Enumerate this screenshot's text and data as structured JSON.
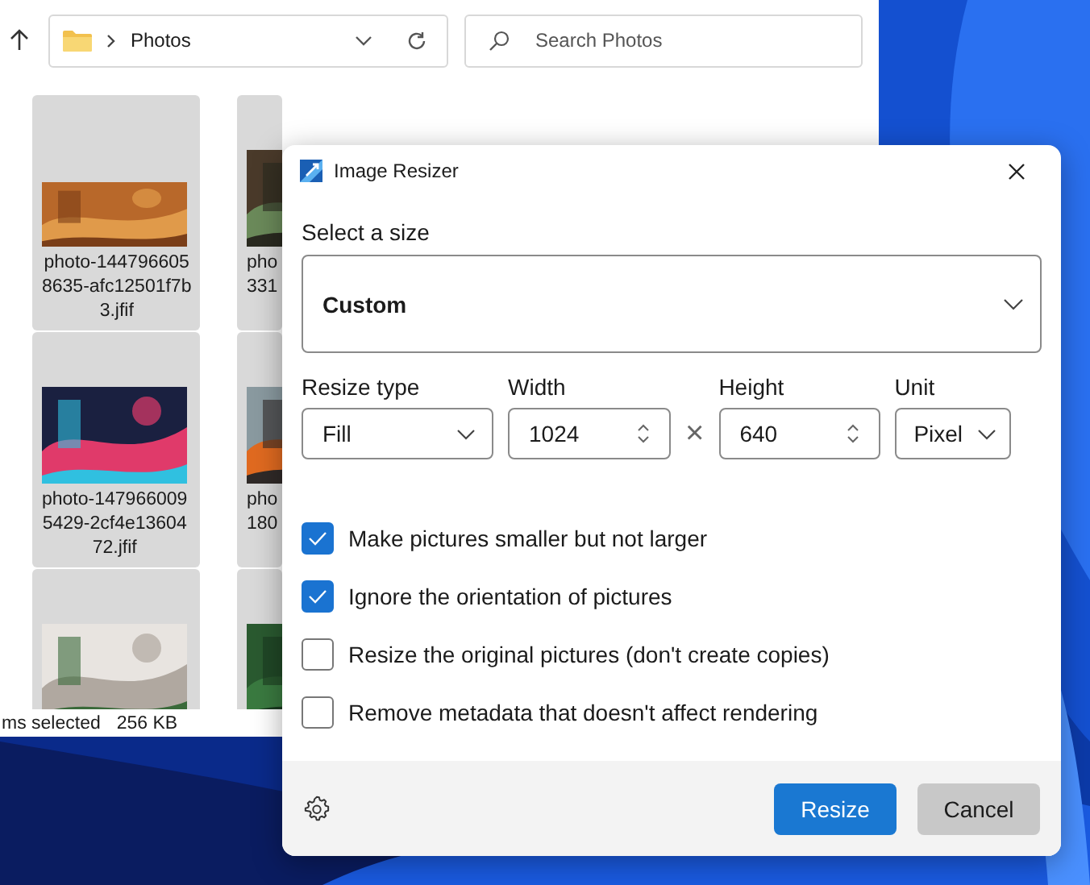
{
  "explorer": {
    "address": {
      "location": "Photos"
    },
    "search": {
      "placeholder": "Search Photos"
    },
    "tiles": [
      {
        "kind": "picture",
        "label_lines": [
          "photo-144796605",
          "8635-afc12501f7b",
          "3.jfif"
        ]
      },
      {
        "kind": "picture",
        "label_lines": [
          "pho",
          "331"
        ]
      },
      {
        "kind": "picture",
        "label_lines": [
          "photo-147966009",
          "5429-2cf4e13604",
          "72.jfif"
        ]
      },
      {
        "kind": "picture",
        "label_lines": [
          "pho",
          "180"
        ]
      },
      {
        "kind": "picture"
      },
      {
        "kind": "picture"
      }
    ],
    "status_bar": {
      "selection": "ms selected",
      "size": "256 KB"
    }
  },
  "dialog": {
    "title": "Image Resizer",
    "size_label": "Select a size",
    "size_value": "Custom",
    "fields": [
      {
        "kind": "dropdown",
        "label": "Resize type",
        "value": "Fill"
      },
      {
        "kind": "number",
        "label": "Width",
        "value": "1024"
      },
      {
        "kind": "separator",
        "value": "×"
      },
      {
        "kind": "number",
        "label": "Height",
        "value": "640"
      },
      {
        "kind": "dropdown",
        "label": "Unit",
        "value": "Pixel"
      }
    ],
    "options": [
      {
        "label": "Make pictures smaller but not larger",
        "checked": true
      },
      {
        "label": "Ignore the orientation of pictures",
        "checked": true
      },
      {
        "label": "Resize the original pictures (don't create copies)",
        "checked": false
      },
      {
        "label": "Remove metadata that doesn't affect rendering",
        "checked": false
      }
    ],
    "buttons": [
      {
        "label": "Resize",
        "kind": "primary"
      },
      {
        "label": "Cancel",
        "kind": "secondary"
      }
    ]
  }
}
